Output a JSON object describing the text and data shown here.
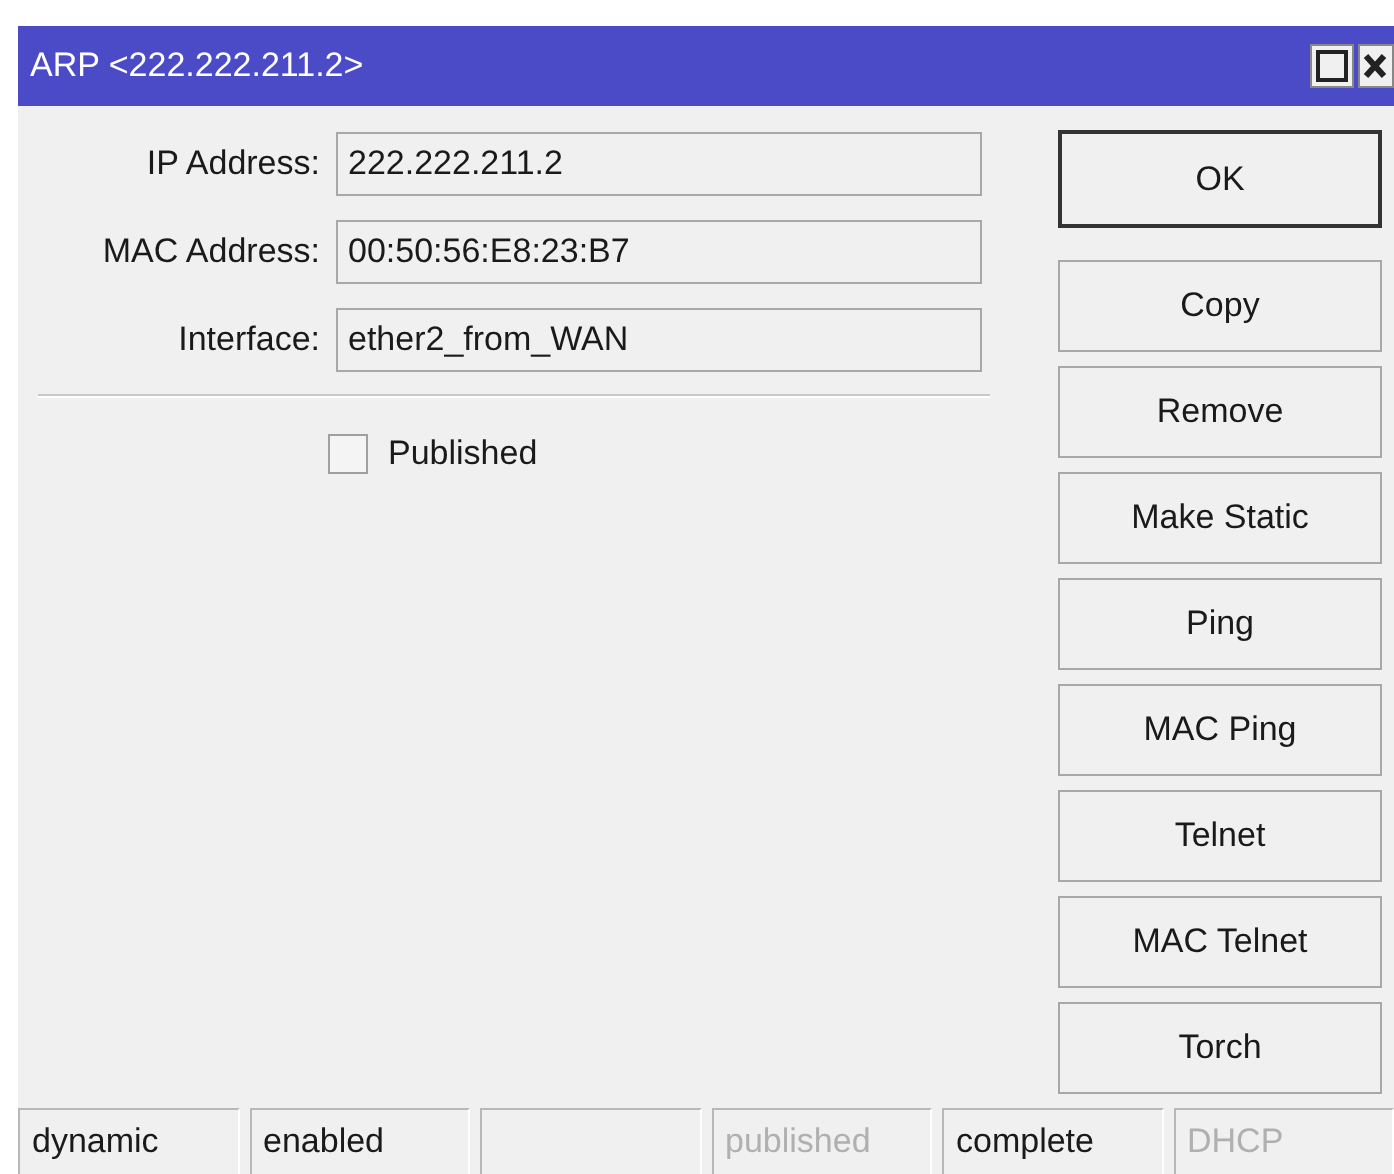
{
  "window": {
    "title": "ARP <222.222.211.2>"
  },
  "fields": [
    {
      "label": "IP Address:",
      "value": "222.222.211.2"
    },
    {
      "label": "MAC Address:",
      "value": "00:50:56:E8:23:B7"
    },
    {
      "label": "Interface:",
      "value": "ether2_from_WAN"
    }
  ],
  "published": {
    "label": "Published",
    "checked": false
  },
  "buttons": [
    {
      "label": "OK",
      "default": true
    },
    {
      "label": "Copy",
      "default": false
    },
    {
      "label": "Remove",
      "default": false
    },
    {
      "label": "Make Static",
      "default": false
    },
    {
      "label": "Ping",
      "default": false
    },
    {
      "label": "MAC Ping",
      "default": false
    },
    {
      "label": "Telnet",
      "default": false
    },
    {
      "label": "MAC Telnet",
      "default": false
    },
    {
      "label": "Torch",
      "default": false
    }
  ],
  "status_bar": [
    {
      "text": "dynamic",
      "disabled": false
    },
    {
      "text": "enabled",
      "disabled": false
    },
    {
      "disabled": false
    },
    {
      "text": "published",
      "disabled": true
    },
    {
      "text": "complete",
      "disabled": false
    },
    {
      "text": "DHCP",
      "disabled": true
    }
  ]
}
